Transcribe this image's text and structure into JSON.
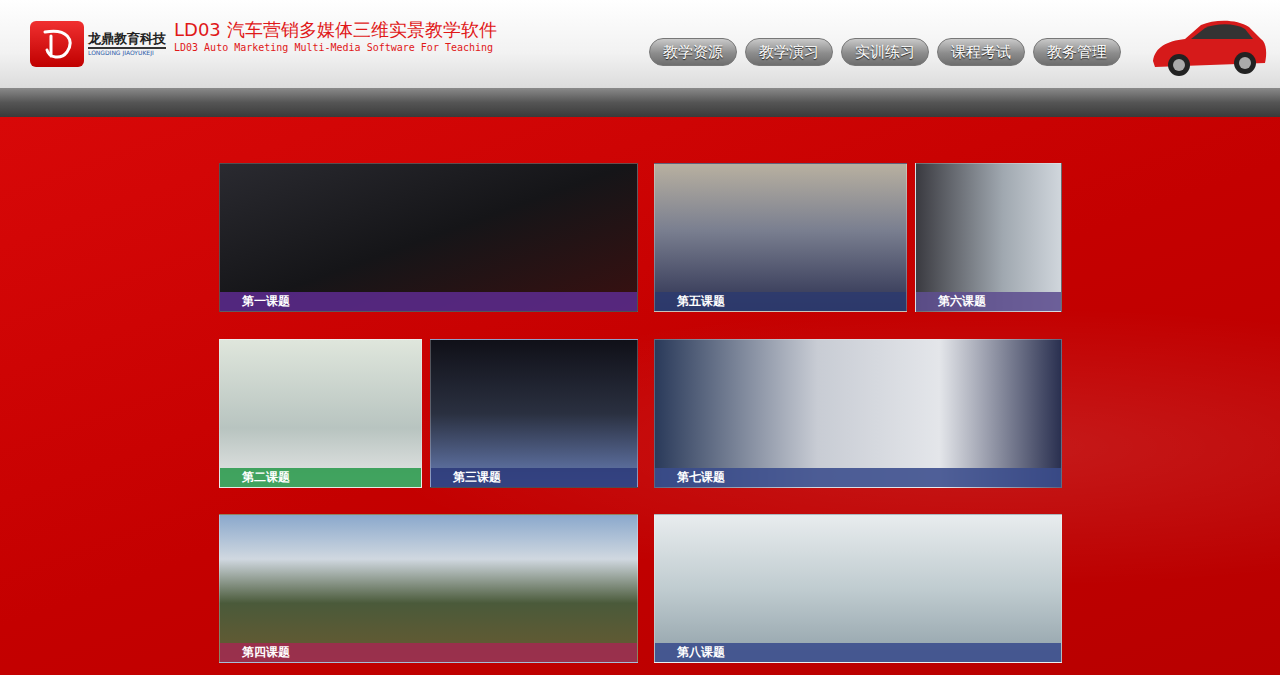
{
  "brand": {
    "name": "龙鼎教育科技",
    "sub": "LONGDING JIAOYUKEJI"
  },
  "app": {
    "title": "LD03 汽车营销多媒体三维实景教学软件",
    "subtitle": "LD03 Auto Marketing Multi-Media Software For Teaching"
  },
  "nav": [
    {
      "label": "教学资源"
    },
    {
      "label": "教学演习"
    },
    {
      "label": "实训练习"
    },
    {
      "label": "课程考试"
    },
    {
      "label": "教务管理"
    }
  ],
  "tiles": [
    {
      "label": "第一课题",
      "color": "#5b2a8c"
    },
    {
      "label": "第五课题",
      "color": "#2c3a6e"
    },
    {
      "label": "第六课题",
      "color": "#5e4e90"
    },
    {
      "label": "第二课题",
      "color": "#2a9a4c"
    },
    {
      "label": "第三课题",
      "color": "#2c3a7a"
    },
    {
      "label": "第七课题",
      "color": "#3a4c8c"
    },
    {
      "label": "第四课题",
      "color": "#a02a50"
    },
    {
      "label": "第八课题",
      "color": "#3a4c8c"
    }
  ]
}
